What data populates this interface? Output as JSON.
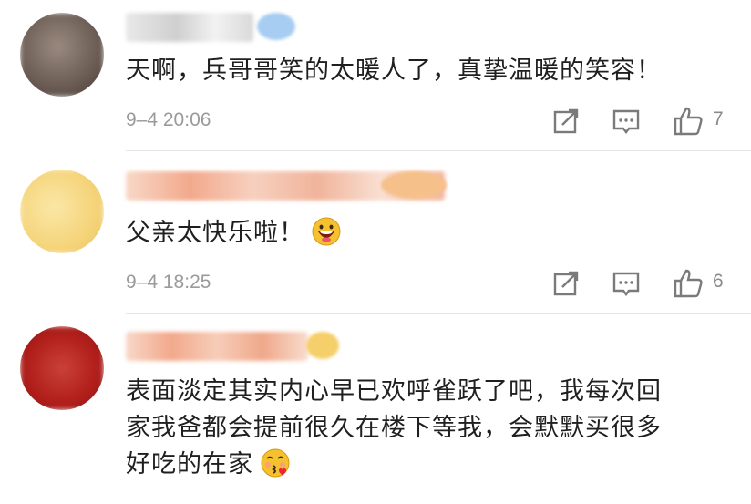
{
  "comments": [
    {
      "text": "天啊，兵哥哥笑的太暖人了，真挚温暖的笑容！",
      "time": "9–4 20:06",
      "likes": "7",
      "avatar_color": "#6e5f57"
    },
    {
      "text": "父亲太快乐啦！",
      "time": "9–4 18:25",
      "likes": "6",
      "avatar_color": "#f5d47a",
      "emoji": "grinning-face-icon"
    },
    {
      "text_lines": [
        "表面淡定其实内心早已欢呼雀跃了吧，我每次回",
        "家我爸都会提前很久在楼下等我，会默默买很多",
        "好吃的在家"
      ],
      "avatar_color": "#b3201c",
      "emoji": "kissing-face-icon"
    }
  ]
}
